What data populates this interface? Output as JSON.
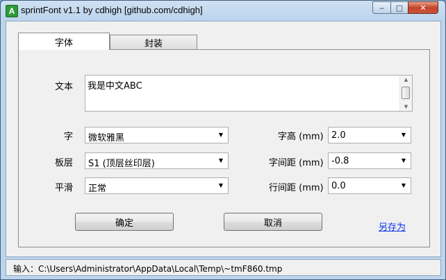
{
  "window": {
    "title": "sprintFont v1.1 by cdhigh [github.com/cdhigh]",
    "app_icon": "A"
  },
  "caption_buttons": {
    "minimize": "‒",
    "maximize": "□",
    "close": "✕"
  },
  "tabs": [
    {
      "label": "字体",
      "active": true
    },
    {
      "label": "封装",
      "active": false
    }
  ],
  "text_field": {
    "label": "文本",
    "value": "我是中文ABC"
  },
  "font": {
    "label": "字",
    "value": "微软雅黑"
  },
  "layer": {
    "label": "板层",
    "value": "S1 (顶层丝印层)"
  },
  "smoothing": {
    "label": "平滑",
    "value": "正常"
  },
  "height": {
    "label": "字高 (mm)",
    "value": "2.0"
  },
  "char_spacing": {
    "label": "字间距 (mm)",
    "value": "-0.8"
  },
  "line_spacing": {
    "label": "行间距 (mm)",
    "value": "0.0"
  },
  "buttons": {
    "ok": "确定",
    "cancel": "取消",
    "save_as": "另存为"
  },
  "status": "输入：C:\\Users\\Administrator\\AppData\\Local\\Temp\\~tmF860.tmp",
  "colors": {
    "link": "#0b36e8",
    "title_bar": "#bcd4ec",
    "close_button": "#c4442a"
  }
}
